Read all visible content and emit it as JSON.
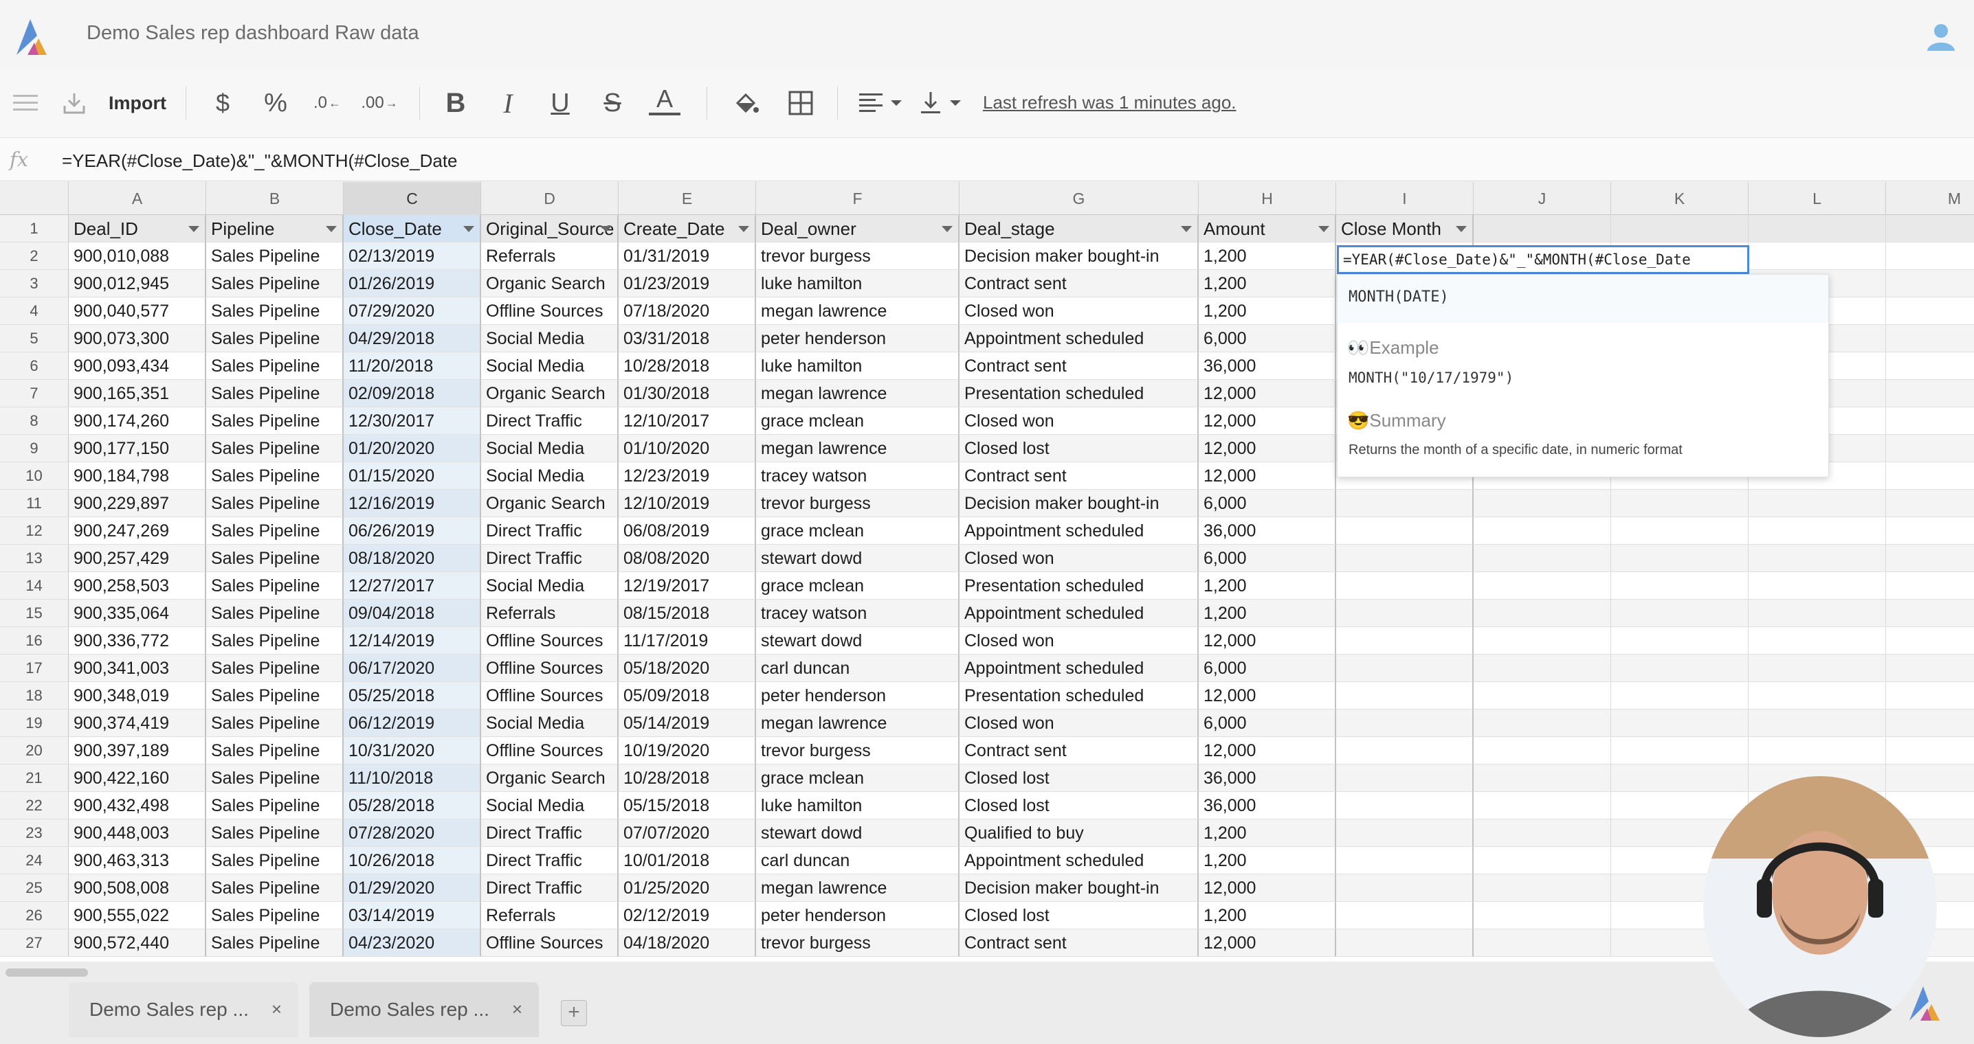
{
  "app": {
    "document_title": "Demo Sales rep dashboard Raw data"
  },
  "toolbar": {
    "import_label": "Import",
    "dollar_label": "$",
    "percent_label": "%",
    "decrease_decimals_label": ".0",
    "increase_decimals_label": ".00",
    "bold_label": "B",
    "italic_label": "I",
    "underline_label": "U",
    "strikethrough_label": "S",
    "text_color_label": "A",
    "refresh_status": "Last refresh was 1 minutes ago."
  },
  "formula_bar": {
    "fx_label": "fx",
    "formula": "=YEAR(#Close_Date)&\"_\"&MONTH(#Close_Date"
  },
  "grid": {
    "column_letters": [
      "A",
      "B",
      "C",
      "D",
      "E",
      "F",
      "G",
      "H",
      "I",
      "J",
      "K",
      "L",
      "M"
    ],
    "selected_column": "C",
    "headers": [
      "Deal_ID",
      "Pipeline",
      "Close_Date",
      "Original_Source",
      "Create_Date",
      "Deal_owner",
      "Deal_stage",
      "Amount",
      "Close Month"
    ],
    "rows": [
      [
        "900,010,088",
        "Sales Pipeline",
        "02/13/2019",
        "Referrals",
        "01/31/2019",
        "trevor burgess",
        "Decision maker bought-in",
        "1,200"
      ],
      [
        "900,012,945",
        "Sales Pipeline",
        "01/26/2019",
        "Organic Search",
        "01/23/2019",
        "luke hamilton",
        "Contract sent",
        "1,200"
      ],
      [
        "900,040,577",
        "Sales Pipeline",
        "07/29/2020",
        "Offline Sources",
        "07/18/2020",
        "megan lawrence",
        "Closed won",
        "1,200"
      ],
      [
        "900,073,300",
        "Sales Pipeline",
        "04/29/2018",
        "Social Media",
        "03/31/2018",
        "peter henderson",
        "Appointment scheduled",
        "6,000"
      ],
      [
        "900,093,434",
        "Sales Pipeline",
        "11/20/2018",
        "Social Media",
        "10/28/2018",
        "luke hamilton",
        "Contract sent",
        "36,000"
      ],
      [
        "900,165,351",
        "Sales Pipeline",
        "02/09/2018",
        "Organic Search",
        "01/30/2018",
        "megan lawrence",
        "Presentation scheduled",
        "12,000"
      ],
      [
        "900,174,260",
        "Sales Pipeline",
        "12/30/2017",
        "Direct Traffic",
        "12/10/2017",
        "grace mclean",
        "Closed won",
        "12,000"
      ],
      [
        "900,177,150",
        "Sales Pipeline",
        "01/20/2020",
        "Social Media",
        "01/10/2020",
        "megan lawrence",
        "Closed lost",
        "12,000"
      ],
      [
        "900,184,798",
        "Sales Pipeline",
        "01/15/2020",
        "Social Media",
        "12/23/2019",
        "tracey watson",
        "Contract sent",
        "12,000"
      ],
      [
        "900,229,897",
        "Sales Pipeline",
        "12/16/2019",
        "Organic Search",
        "12/10/2019",
        "trevor burgess",
        "Decision maker bought-in",
        "6,000"
      ],
      [
        "900,247,269",
        "Sales Pipeline",
        "06/26/2019",
        "Direct Traffic",
        "06/08/2019",
        "grace mclean",
        "Appointment scheduled",
        "36,000"
      ],
      [
        "900,257,429",
        "Sales Pipeline",
        "08/18/2020",
        "Direct Traffic",
        "08/08/2020",
        "stewart dowd",
        "Closed won",
        "6,000"
      ],
      [
        "900,258,503",
        "Sales Pipeline",
        "12/27/2017",
        "Social Media",
        "12/19/2017",
        "grace mclean",
        "Presentation scheduled",
        "1,200"
      ],
      [
        "900,335,064",
        "Sales Pipeline",
        "09/04/2018",
        "Referrals",
        "08/15/2018",
        "tracey watson",
        "Appointment scheduled",
        "1,200"
      ],
      [
        "900,336,772",
        "Sales Pipeline",
        "12/14/2019",
        "Offline Sources",
        "11/17/2019",
        "stewart dowd",
        "Closed won",
        "12,000"
      ],
      [
        "900,341,003",
        "Sales Pipeline",
        "06/17/2020",
        "Offline Sources",
        "05/18/2020",
        "carl duncan",
        "Appointment scheduled",
        "6,000"
      ],
      [
        "900,348,019",
        "Sales Pipeline",
        "05/25/2018",
        "Offline Sources",
        "05/09/2018",
        "peter henderson",
        "Presentation scheduled",
        "12,000"
      ],
      [
        "900,374,419",
        "Sales Pipeline",
        "06/12/2019",
        "Social Media",
        "05/14/2019",
        "megan lawrence",
        "Closed won",
        "6,000"
      ],
      [
        "900,397,189",
        "Sales Pipeline",
        "10/31/2020",
        "Offline Sources",
        "10/19/2020",
        "trevor burgess",
        "Contract sent",
        "12,000"
      ],
      [
        "900,422,160",
        "Sales Pipeline",
        "11/10/2018",
        "Organic Search",
        "10/28/2018",
        "grace mclean",
        "Closed lost",
        "36,000"
      ],
      [
        "900,432,498",
        "Sales Pipeline",
        "05/28/2018",
        "Social Media",
        "05/15/2018",
        "luke hamilton",
        "Closed lost",
        "36,000"
      ],
      [
        "900,448,003",
        "Sales Pipeline",
        "07/28/2020",
        "Direct Traffic",
        "07/07/2020",
        "stewart dowd",
        "Qualified to buy",
        "1,200"
      ],
      [
        "900,463,313",
        "Sales Pipeline",
        "10/26/2018",
        "Direct Traffic",
        "10/01/2018",
        "carl duncan",
        "Appointment scheduled",
        "1,200"
      ],
      [
        "900,508,008",
        "Sales Pipeline",
        "01/29/2020",
        "Direct Traffic",
        "01/25/2020",
        "megan lawrence",
        "Decision maker bought-in",
        "12,000"
      ],
      [
        "900,555,022",
        "Sales Pipeline",
        "03/14/2019",
        "Referrals",
        "02/12/2019",
        "peter henderson",
        "Closed lost",
        "1,200"
      ],
      [
        "900,572,440",
        "Sales Pipeline",
        "04/23/2020",
        "Offline Sources",
        "04/18/2020",
        "trevor burgess",
        "Contract sent",
        "12,000"
      ]
    ]
  },
  "active_cell": {
    "value": "=YEAR(#Close_Date)&\"_\"&MONTH(#Close_Date"
  },
  "function_tooltip": {
    "signature": "MONTH(DATE)",
    "example_heading": "Example",
    "example": "MONTH(\"10/17/1979\")",
    "summary_heading": "Summary",
    "summary": "Returns the month of a specific date, in numeric format"
  },
  "sheet_tabs": [
    {
      "label": "Demo Sales rep ...",
      "close": "×"
    },
    {
      "label": "Demo Sales rep ...",
      "close": "×"
    }
  ],
  "add_sheet_label": "+"
}
